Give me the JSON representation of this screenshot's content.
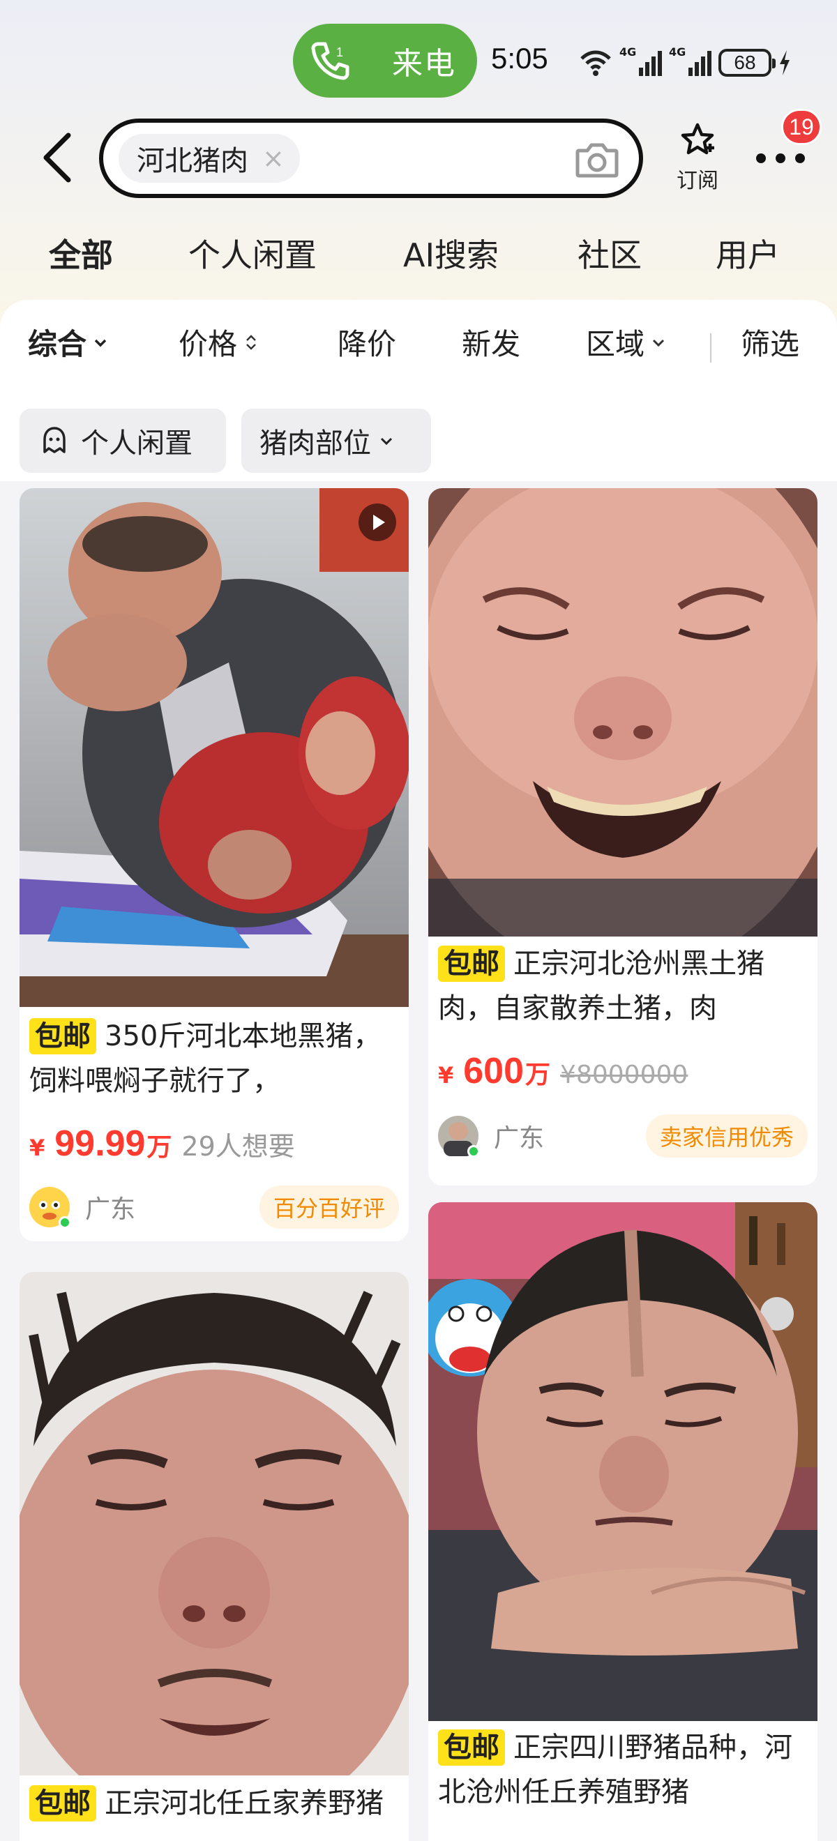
{
  "status_bar": {
    "call_label": "来电",
    "time": "5:05",
    "network_label": "4G",
    "battery": "68"
  },
  "search": {
    "query": "河北猪肉",
    "clear_glyph": "×"
  },
  "header": {
    "subscribe_label": "订阅",
    "more_badge": "19"
  },
  "main_tabs": [
    {
      "label": "全部",
      "active": true
    },
    {
      "label": "个人闲置"
    },
    {
      "label": "AI搜索"
    },
    {
      "label": "社区"
    },
    {
      "label": "用户"
    }
  ],
  "filters": [
    {
      "label": "综合",
      "active": true
    },
    {
      "label": "价格"
    },
    {
      "label": "降价"
    },
    {
      "label": "新发"
    },
    {
      "label": "区域"
    },
    {
      "label": "筛选"
    }
  ],
  "chips": [
    {
      "label": "个人闲置",
      "icon": "user-icon"
    },
    {
      "label": "猪肉部位",
      "icon": "chevron-down-icon"
    }
  ],
  "listings": [
    {
      "tag": "包邮",
      "title": "350斤河北本地黑猪，饲料喂焖子就行了，",
      "currency": "¥",
      "price": "99.99",
      "unit": "万",
      "meta": "29人想要",
      "location": "广东",
      "badge": "百分百好评",
      "has_video": true
    },
    {
      "tag": "包邮",
      "title": "正宗河北沧州黑土猪肉，自家散养土猪，肉",
      "currency": "¥",
      "price": "600",
      "unit": "万",
      "original_price": "¥8000000",
      "location": "广东",
      "badge": "卖家信用优秀"
    },
    {
      "tag": "包邮",
      "title": "正宗河北任丘家养野猪"
    },
    {
      "tag": "包邮",
      "title": "正宗四川野猪品种，河北沧州任丘养殖野猪"
    }
  ],
  "colors": {
    "accent_yellow": "#ffe11a",
    "price_red": "#ff3b2f",
    "call_green": "#5bb044",
    "badge_orange": "#f08a00"
  }
}
